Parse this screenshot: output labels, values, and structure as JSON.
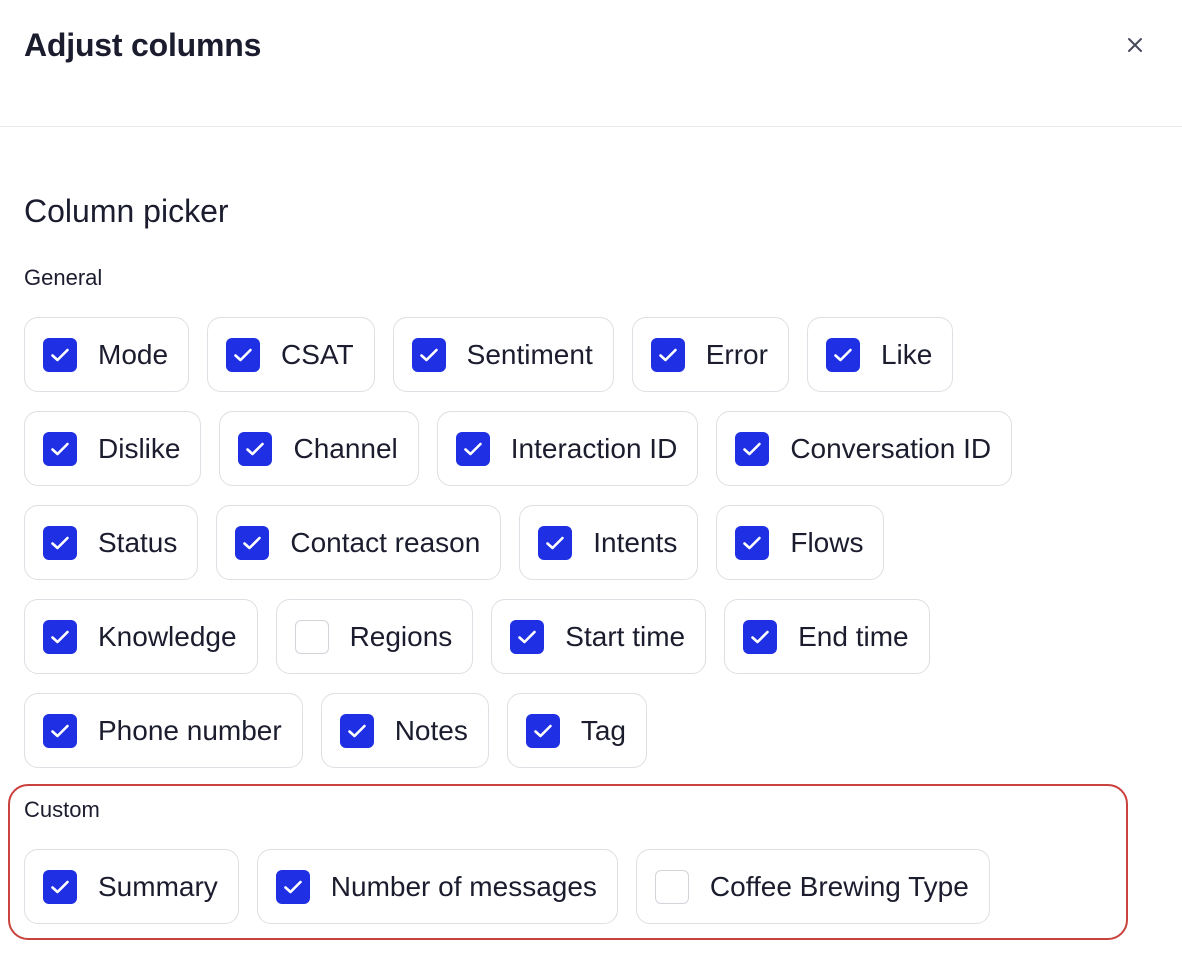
{
  "dialog": {
    "title": "Adjust columns",
    "close_icon": "close-icon"
  },
  "picker": {
    "title": "Column picker",
    "groups": [
      {
        "label": "General",
        "items": [
          {
            "label": "Mode",
            "checked": true
          },
          {
            "label": "CSAT",
            "checked": true
          },
          {
            "label": "Sentiment",
            "checked": true
          },
          {
            "label": "Error",
            "checked": true
          },
          {
            "label": "Like",
            "checked": true
          },
          {
            "label": "Dislike",
            "checked": true
          },
          {
            "label": "Channel",
            "checked": true
          },
          {
            "label": "Interaction ID",
            "checked": true
          },
          {
            "label": "Conversation ID",
            "checked": true
          },
          {
            "label": "Status",
            "checked": true
          },
          {
            "label": "Contact reason",
            "checked": true
          },
          {
            "label": "Intents",
            "checked": true
          },
          {
            "label": "Flows",
            "checked": true
          },
          {
            "label": "Knowledge",
            "checked": true
          },
          {
            "label": "Regions",
            "checked": false
          },
          {
            "label": "Start time",
            "checked": true
          },
          {
            "label": "End time",
            "checked": true
          },
          {
            "label": "Phone number",
            "checked": true
          },
          {
            "label": "Notes",
            "checked": true
          },
          {
            "label": "Tag",
            "checked": true
          }
        ]
      },
      {
        "label": "Custom",
        "items": [
          {
            "label": "Summary",
            "checked": true
          },
          {
            "label": "Number of messages",
            "checked": true
          },
          {
            "label": "Coffee Brewing Type",
            "checked": false
          }
        ]
      }
    ]
  },
  "colors": {
    "checkbox_checked": "#1f2fe3",
    "highlight_border": "#c9423c",
    "chip_border": "#dedfe4"
  }
}
